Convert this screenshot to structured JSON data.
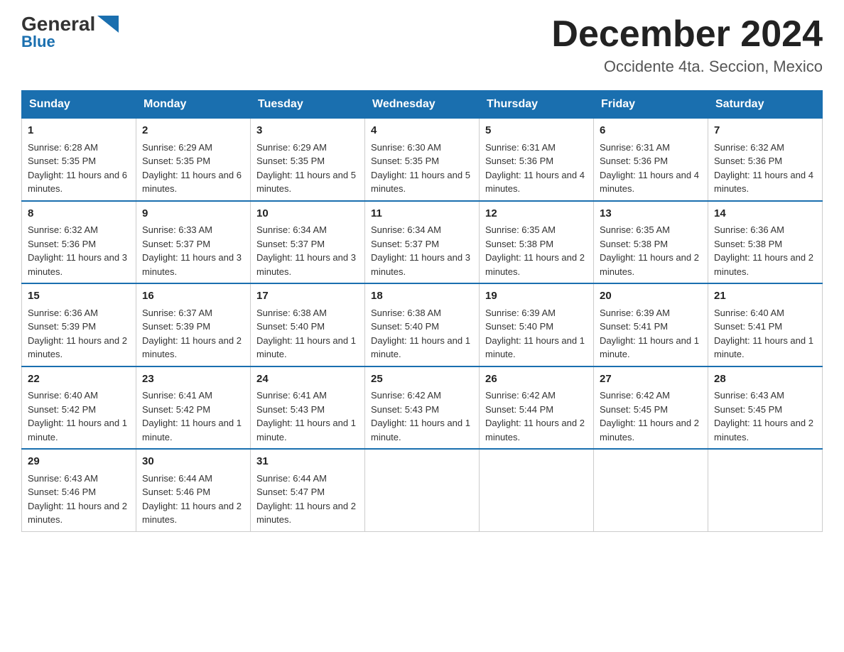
{
  "header": {
    "logo": {
      "general": "General",
      "blue": "Blue"
    },
    "title": "December 2024",
    "location": "Occidente 4ta. Seccion, Mexico"
  },
  "columns": [
    "Sunday",
    "Monday",
    "Tuesday",
    "Wednesday",
    "Thursday",
    "Friday",
    "Saturday"
  ],
  "weeks": [
    [
      {
        "day": "1",
        "sunrise": "6:28 AM",
        "sunset": "5:35 PM",
        "daylight": "11 hours and 6 minutes."
      },
      {
        "day": "2",
        "sunrise": "6:29 AM",
        "sunset": "5:35 PM",
        "daylight": "11 hours and 6 minutes."
      },
      {
        "day": "3",
        "sunrise": "6:29 AM",
        "sunset": "5:35 PM",
        "daylight": "11 hours and 5 minutes."
      },
      {
        "day": "4",
        "sunrise": "6:30 AM",
        "sunset": "5:35 PM",
        "daylight": "11 hours and 5 minutes."
      },
      {
        "day": "5",
        "sunrise": "6:31 AM",
        "sunset": "5:36 PM",
        "daylight": "11 hours and 4 minutes."
      },
      {
        "day": "6",
        "sunrise": "6:31 AM",
        "sunset": "5:36 PM",
        "daylight": "11 hours and 4 minutes."
      },
      {
        "day": "7",
        "sunrise": "6:32 AM",
        "sunset": "5:36 PM",
        "daylight": "11 hours and 4 minutes."
      }
    ],
    [
      {
        "day": "8",
        "sunrise": "6:32 AM",
        "sunset": "5:36 PM",
        "daylight": "11 hours and 3 minutes."
      },
      {
        "day": "9",
        "sunrise": "6:33 AM",
        "sunset": "5:37 PM",
        "daylight": "11 hours and 3 minutes."
      },
      {
        "day": "10",
        "sunrise": "6:34 AM",
        "sunset": "5:37 PM",
        "daylight": "11 hours and 3 minutes."
      },
      {
        "day": "11",
        "sunrise": "6:34 AM",
        "sunset": "5:37 PM",
        "daylight": "11 hours and 3 minutes."
      },
      {
        "day": "12",
        "sunrise": "6:35 AM",
        "sunset": "5:38 PM",
        "daylight": "11 hours and 2 minutes."
      },
      {
        "day": "13",
        "sunrise": "6:35 AM",
        "sunset": "5:38 PM",
        "daylight": "11 hours and 2 minutes."
      },
      {
        "day": "14",
        "sunrise": "6:36 AM",
        "sunset": "5:38 PM",
        "daylight": "11 hours and 2 minutes."
      }
    ],
    [
      {
        "day": "15",
        "sunrise": "6:36 AM",
        "sunset": "5:39 PM",
        "daylight": "11 hours and 2 minutes."
      },
      {
        "day": "16",
        "sunrise": "6:37 AM",
        "sunset": "5:39 PM",
        "daylight": "11 hours and 2 minutes."
      },
      {
        "day": "17",
        "sunrise": "6:38 AM",
        "sunset": "5:40 PM",
        "daylight": "11 hours and 1 minute."
      },
      {
        "day": "18",
        "sunrise": "6:38 AM",
        "sunset": "5:40 PM",
        "daylight": "11 hours and 1 minute."
      },
      {
        "day": "19",
        "sunrise": "6:39 AM",
        "sunset": "5:40 PM",
        "daylight": "11 hours and 1 minute."
      },
      {
        "day": "20",
        "sunrise": "6:39 AM",
        "sunset": "5:41 PM",
        "daylight": "11 hours and 1 minute."
      },
      {
        "day": "21",
        "sunrise": "6:40 AM",
        "sunset": "5:41 PM",
        "daylight": "11 hours and 1 minute."
      }
    ],
    [
      {
        "day": "22",
        "sunrise": "6:40 AM",
        "sunset": "5:42 PM",
        "daylight": "11 hours and 1 minute."
      },
      {
        "day": "23",
        "sunrise": "6:41 AM",
        "sunset": "5:42 PM",
        "daylight": "11 hours and 1 minute."
      },
      {
        "day": "24",
        "sunrise": "6:41 AM",
        "sunset": "5:43 PM",
        "daylight": "11 hours and 1 minute."
      },
      {
        "day": "25",
        "sunrise": "6:42 AM",
        "sunset": "5:43 PM",
        "daylight": "11 hours and 1 minute."
      },
      {
        "day": "26",
        "sunrise": "6:42 AM",
        "sunset": "5:44 PM",
        "daylight": "11 hours and 2 minutes."
      },
      {
        "day": "27",
        "sunrise": "6:42 AM",
        "sunset": "5:45 PM",
        "daylight": "11 hours and 2 minutes."
      },
      {
        "day": "28",
        "sunrise": "6:43 AM",
        "sunset": "5:45 PM",
        "daylight": "11 hours and 2 minutes."
      }
    ],
    [
      {
        "day": "29",
        "sunrise": "6:43 AM",
        "sunset": "5:46 PM",
        "daylight": "11 hours and 2 minutes."
      },
      {
        "day": "30",
        "sunrise": "6:44 AM",
        "sunset": "5:46 PM",
        "daylight": "11 hours and 2 minutes."
      },
      {
        "day": "31",
        "sunrise": "6:44 AM",
        "sunset": "5:47 PM",
        "daylight": "11 hours and 2 minutes."
      },
      null,
      null,
      null,
      null
    ]
  ]
}
